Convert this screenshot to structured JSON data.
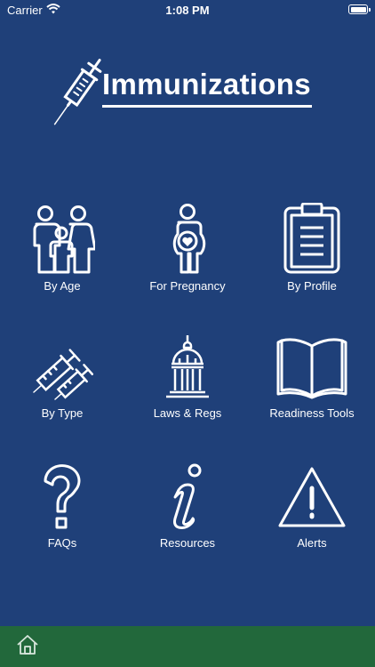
{
  "status_bar": {
    "carrier": "Carrier",
    "time": "1:08 PM"
  },
  "header": {
    "title": "Immunizations",
    "logo_icon": "syringe-icon"
  },
  "tiles": [
    {
      "label": "By Age",
      "icon": "family-icon"
    },
    {
      "label": "For Pregnancy",
      "icon": "pregnant-woman-icon"
    },
    {
      "label": "By Profile",
      "icon": "clipboard-icon"
    },
    {
      "label": "By Type",
      "icon": "syringes-icon"
    },
    {
      "label": "Laws & Regs",
      "icon": "capitol-building-icon"
    },
    {
      "label": "Readiness Tools",
      "icon": "open-book-icon"
    },
    {
      "label": "FAQs",
      "icon": "question-mark-icon"
    },
    {
      "label": "Resources",
      "icon": "info-icon"
    },
    {
      "label": "Alerts",
      "icon": "warning-triangle-icon"
    }
  ],
  "tabbar": {
    "home_icon": "home-icon"
  },
  "colors": {
    "background": "#1f4079",
    "tabbar": "#22683b",
    "foreground": "#ffffff"
  }
}
